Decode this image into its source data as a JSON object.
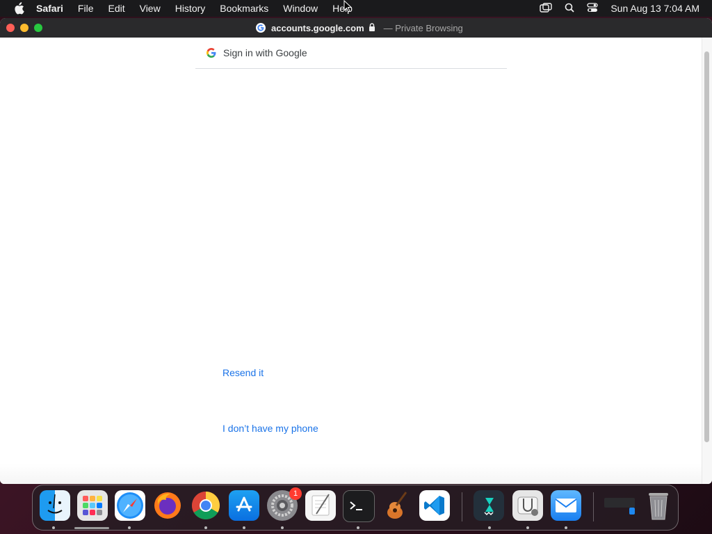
{
  "menubar": {
    "app_name": "Safari",
    "items": [
      "File",
      "Edit",
      "View",
      "History",
      "Bookmarks",
      "Window",
      "Help"
    ],
    "clock": "Sun Aug 13  7:04 AM"
  },
  "browser": {
    "url": "accounts.google.com",
    "mode": "— Private Browsing"
  },
  "page": {
    "header_label": "Sign in with Google",
    "resend_link": "Resend it",
    "no_phone_link": "I don’t have my phone"
  },
  "dock": {
    "settings_badge": "1"
  },
  "colors": {
    "link": "#1a73e8",
    "menubar_bg": "#1a1a1c",
    "titlebar_bg": "#2a2a2c"
  }
}
